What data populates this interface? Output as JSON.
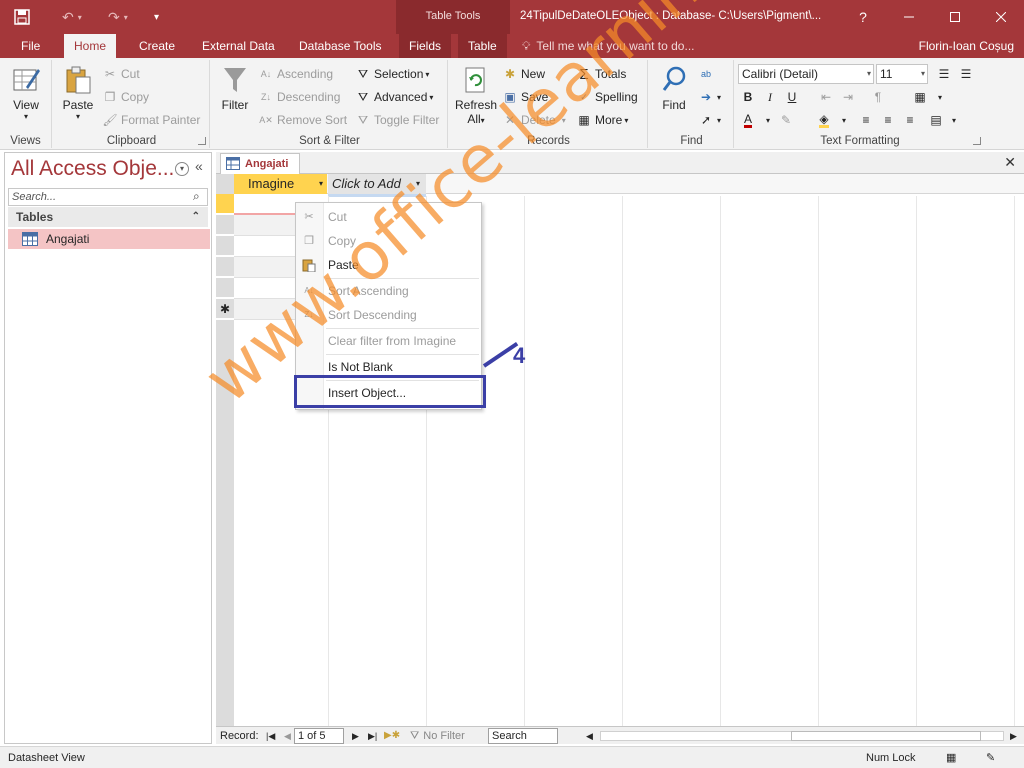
{
  "titlebar": {
    "context_tools": "Table Tools",
    "document_title": "24TipulDeDateOLEObject : Database- C:\\Users\\Pigment\\...",
    "help": "?"
  },
  "tabs": [
    {
      "label": "File"
    },
    {
      "label": "Home"
    },
    {
      "label": "Create"
    },
    {
      "label": "External Data"
    },
    {
      "label": "Database Tools"
    },
    {
      "label": "Fields"
    },
    {
      "label": "Table"
    }
  ],
  "tellme": "Tell me what you want to do...",
  "user": "Florin-Ioan Coșug",
  "ribbon": {
    "views": {
      "view": "View",
      "label": "Views"
    },
    "clipboard": {
      "paste": "Paste",
      "cut": "Cut",
      "copy": "Copy",
      "format_painter": "Format Painter",
      "label": "Clipboard"
    },
    "sort_filter": {
      "filter": "Filter",
      "ascending": "Ascending",
      "descending": "Descending",
      "remove_sort": "Remove Sort",
      "selection": "Selection",
      "advanced": "Advanced",
      "toggle_filter": "Toggle Filter",
      "label": "Sort & Filter"
    },
    "records": {
      "refresh": "Refresh",
      "refresh_all": "All",
      "new": "New",
      "save": "Save",
      "delete": "Delete",
      "totals": "Totals",
      "spelling": "Spelling",
      "more": "More",
      "label": "Records"
    },
    "find": {
      "find": "Find",
      "label": "Find"
    },
    "text_formatting": {
      "font": "Calibri (Detail)",
      "size": "11",
      "bold": "B",
      "italic": "I",
      "underline": "U",
      "label": "Text Formatting"
    }
  },
  "nav": {
    "title": "All Access Obje...",
    "search_placeholder": "Search...",
    "group": "Tables",
    "items": [
      {
        "label": "Angajati"
      }
    ]
  },
  "document": {
    "tab": "Angajati",
    "columns": [
      "Imagine",
      "Click to Add"
    ],
    "new_row_marker": "✱"
  },
  "context_menu": {
    "items": [
      {
        "label": "Cut",
        "enabled": false
      },
      {
        "label": "Copy",
        "enabled": false
      },
      {
        "label": "Paste",
        "enabled": true
      },
      {
        "label": "Sort Ascending",
        "enabled": false
      },
      {
        "label": "Sort Descending",
        "enabled": false
      },
      {
        "label": "Clear filter from Imagine",
        "enabled": false
      },
      {
        "label": "Is Not Blank",
        "enabled": true
      },
      {
        "label": "Insert Object...",
        "enabled": true
      }
    ]
  },
  "record_nav": {
    "label": "Record:",
    "position": "1 of 5",
    "filter": "No Filter",
    "search": "Search"
  },
  "status": {
    "view": "Datasheet View",
    "numlock": "Num Lock"
  },
  "annotation": {
    "number": "4"
  },
  "watermark": "www.office-learning.ro",
  "colors": {
    "accent": "#a4373a",
    "header_yellow": "#ffd34f",
    "annotation": "#3b3fa6",
    "watermark": "#f58c28",
    "selected_item": "#f4c4c5"
  }
}
